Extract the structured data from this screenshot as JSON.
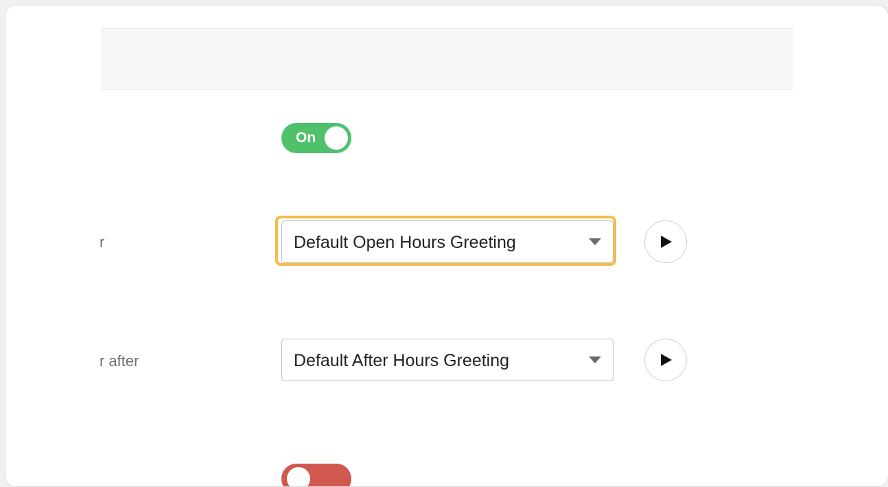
{
  "greeting_settings": {
    "enabled_toggle": {
      "label": "On",
      "state": "on",
      "color": "#4fc16b"
    },
    "open_hours": {
      "label_fragment": "r",
      "selected": "Default Open Hours Greeting",
      "play_icon": "play-icon",
      "highlighted": true
    },
    "after_hours": {
      "label_fragment": "r after",
      "selected": "Default After Hours Greeting",
      "play_icon": "play-icon"
    },
    "second_toggle": {
      "state": "off",
      "color": "#d0584e"
    }
  },
  "colors": {
    "highlight": "#f4be48",
    "on": "#4fc16b",
    "off": "#d0584e"
  }
}
